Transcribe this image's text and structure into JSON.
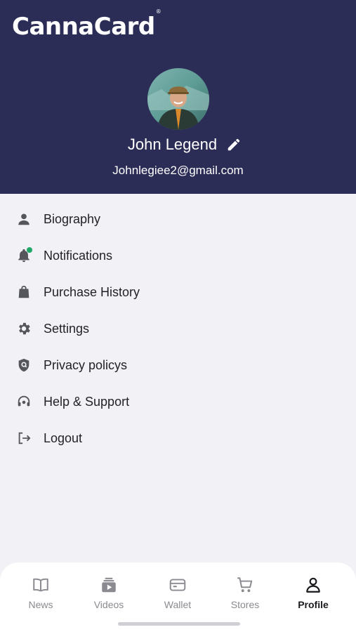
{
  "app": {
    "logo_text": "CannaCard",
    "logo_mark": "®"
  },
  "profile": {
    "name": "John Legend",
    "email": "Johnlegiee2@gmail.com"
  },
  "menu": {
    "items": [
      {
        "label": "Biography",
        "icon": "person-icon"
      },
      {
        "label": "Notifications",
        "icon": "bell-icon"
      },
      {
        "label": "Purchase History",
        "icon": "shopping-bag-icon"
      },
      {
        "label": "Settings",
        "icon": "gear-icon"
      },
      {
        "label": "Privacy policys",
        "icon": "shield-icon"
      },
      {
        "label": "Help & Support",
        "icon": "headset-icon"
      },
      {
        "label": "Logout",
        "icon": "logout-icon"
      }
    ]
  },
  "tabbar": {
    "tabs": [
      {
        "label": "News",
        "icon": "book-icon"
      },
      {
        "label": "Videos",
        "icon": "video-icon"
      },
      {
        "label": "Wallet",
        "icon": "wallet-icon"
      },
      {
        "label": "Stores",
        "icon": "cart-icon"
      },
      {
        "label": "Profile",
        "icon": "profile-icon",
        "active": true
      }
    ]
  },
  "colors": {
    "header_bg": "#2c2d56",
    "page_bg": "#f1f1f6",
    "notification_dot": "#1fa968",
    "icon_gray": "#55555c"
  }
}
